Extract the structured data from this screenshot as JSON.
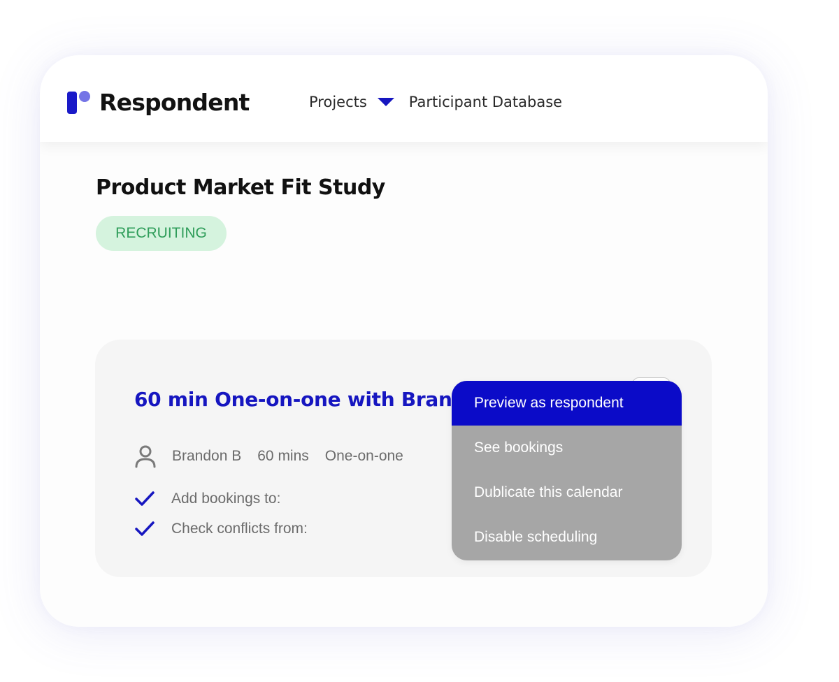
{
  "app": {
    "brand": "Respondent",
    "brand_colors": {
      "primary": "#1a1ac8",
      "secondary": "#7474e6"
    }
  },
  "nav": {
    "items": [
      {
        "label": "Projects",
        "has_dropdown": true
      },
      {
        "label": "Participant Database",
        "has_dropdown": false
      }
    ],
    "caret_icon": "caret-down-icon",
    "accent_color": "#1616c0"
  },
  "project": {
    "title": "Product Market Fit Study",
    "status": "RECRUITING",
    "status_colors": {
      "background": "#d5f3de",
      "text": "#2f9d5a"
    }
  },
  "calendar_card": {
    "title": "60 min One-on-one with Brandon",
    "host_icon": "person-icon",
    "host": "Brandon B",
    "duration": "60 mins",
    "type": "One-on-one",
    "options_icon": "kebab-menu-icon",
    "checks": [
      {
        "icon": "checkmark-icon",
        "label": "Add bookings to:"
      },
      {
        "icon": "checkmark-icon",
        "label": "Check conflicts from:"
      }
    ]
  },
  "options_menu": {
    "items": [
      {
        "label": "Preview as respondent",
        "active": true
      },
      {
        "label": "See bookings",
        "active": false
      },
      {
        "label": "Dublicate this calendar",
        "active": false
      },
      {
        "label": "Disable scheduling",
        "active": false
      }
    ],
    "colors": {
      "active_background": "#0b0bc8",
      "background": "#a6a6a6",
      "text": "#ffffff"
    }
  }
}
